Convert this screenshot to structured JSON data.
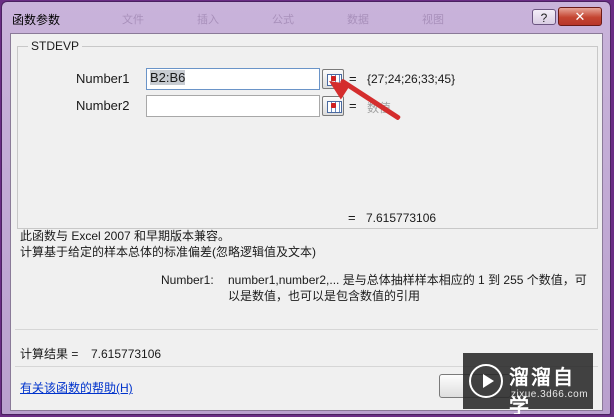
{
  "window": {
    "title": "函数参数",
    "ghost_tabs": [
      "文件",
      "插入",
      "公式",
      "数据",
      "视图"
    ],
    "help_label": "?",
    "close_label": "✕"
  },
  "function": {
    "name": "STDEVP",
    "args": [
      {
        "label": "Number1",
        "value": "B2:B6",
        "equals": "=",
        "result": "{27;24;26;33;45}"
      },
      {
        "label": "Number2",
        "value": "",
        "equals": "=",
        "result": "数值"
      }
    ],
    "formula_equals": "=",
    "formula_result": "7.615773106"
  },
  "description": {
    "line1": "此函数与 Excel 2007 和早期版本兼容。",
    "line2": "计算基于给定的样本总体的标准偏差(忽略逻辑值及文本)",
    "param_name": "Number1:",
    "param_line1": "number1,number2,... 是与总体抽样样本相应的 1 到 255 个数值，可",
    "param_line2": "以是数值，也可以是包含数值的引用"
  },
  "footer": {
    "result_label": "计算结果 =",
    "result_value": "7.615773106",
    "help_link": "有关该函数的帮助(H)",
    "ok_label": ""
  },
  "watermark": {
    "name": "溜溜自学",
    "url": "zixue.3d66.com"
  },
  "colors": {
    "title_bg": "#c0a8d4",
    "frame": "#6a2d84",
    "arrow": "#d42d2d",
    "link": "#0033cc"
  }
}
